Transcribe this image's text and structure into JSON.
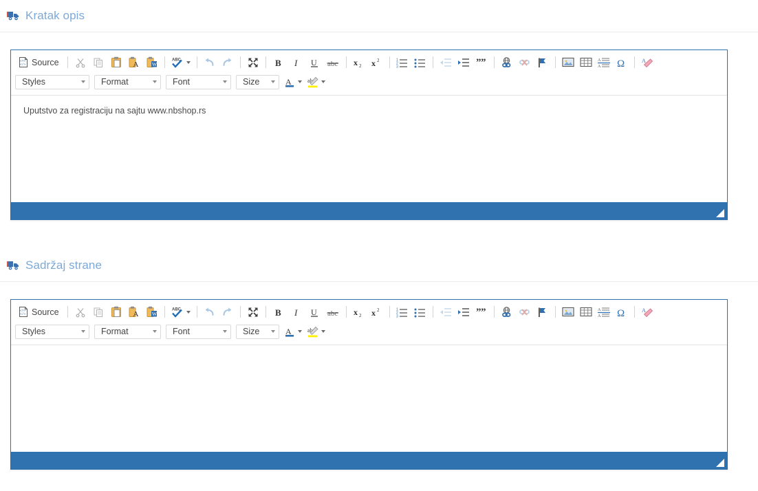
{
  "page": {
    "background": "#ffffff",
    "accent_blue": "#3072b0",
    "header_text_color": "#7da9d8"
  },
  "sections": [
    {
      "id": "kratak-opis",
      "header": {
        "icon": "truck-icon",
        "title": "Kratak opis"
      },
      "editor": {
        "content": "Uputstvo za registraciju na sajtu www.nbshop.rs"
      }
    },
    {
      "id": "sadrzaj-strane",
      "header": {
        "icon": "truck-icon",
        "title": "Sadržaj strane"
      },
      "editor": {
        "content": ""
      }
    }
  ],
  "toolbar": {
    "source_label": "Source",
    "row1": [
      {
        "name": "source-button",
        "label": "Source",
        "icon": "source-code-icon",
        "enabled": true
      },
      {
        "name": "cut-button",
        "icon": "scissors-icon",
        "enabled": false
      },
      {
        "name": "copy-button",
        "icon": "copy-icon",
        "enabled": false
      },
      {
        "name": "paste-button",
        "icon": "paste-icon",
        "enabled": true
      },
      {
        "name": "paste-as-text-button",
        "icon": "paste-text-icon",
        "enabled": true
      },
      {
        "name": "paste-from-word-button",
        "icon": "paste-word-icon",
        "enabled": true
      },
      {
        "name": "spell-check-button",
        "icon": "spell-check-icon",
        "enabled": true
      },
      {
        "name": "undo-button",
        "icon": "undo-icon",
        "enabled": false
      },
      {
        "name": "redo-button",
        "icon": "redo-icon",
        "enabled": false
      },
      {
        "name": "maximize-button",
        "icon": "maximize-icon",
        "enabled": true
      },
      {
        "name": "bold-button",
        "icon": "bold-icon",
        "enabled": true
      },
      {
        "name": "italic-button",
        "icon": "italic-icon",
        "enabled": true
      },
      {
        "name": "underline-button",
        "icon": "underline-icon",
        "enabled": true
      },
      {
        "name": "strikethrough-button",
        "icon": "strikethrough-icon",
        "enabled": true
      },
      {
        "name": "subscript-button",
        "icon": "subscript-icon",
        "enabled": true
      },
      {
        "name": "superscript-button",
        "icon": "superscript-icon",
        "enabled": true
      },
      {
        "name": "numbered-list-button",
        "icon": "numbered-list-icon",
        "enabled": true
      },
      {
        "name": "bulleted-list-button",
        "icon": "bulleted-list-icon",
        "enabled": true
      },
      {
        "name": "outdent-button",
        "icon": "outdent-icon",
        "enabled": false
      },
      {
        "name": "indent-button",
        "icon": "indent-icon",
        "enabled": true
      },
      {
        "name": "blockquote-button",
        "icon": "blockquote-icon",
        "enabled": true
      },
      {
        "name": "link-button",
        "icon": "link-icon",
        "enabled": true
      },
      {
        "name": "unlink-button",
        "icon": "unlink-icon",
        "enabled": false
      },
      {
        "name": "anchor-button",
        "icon": "anchor-flag-icon",
        "enabled": true
      },
      {
        "name": "image-button",
        "icon": "image-icon",
        "enabled": true
      },
      {
        "name": "table-button",
        "icon": "table-icon",
        "enabled": true
      },
      {
        "name": "horizontal-rule-button",
        "icon": "horizontal-rule-icon",
        "enabled": true
      },
      {
        "name": "special-char-button",
        "icon": "omega-icon",
        "enabled": true
      },
      {
        "name": "remove-format-button",
        "icon": "remove-format-icon",
        "enabled": true
      }
    ],
    "combos": {
      "styles": "Styles",
      "format": "Format",
      "font": "Font",
      "size": "Size"
    },
    "text_color_label": "A",
    "bg_color_label": "ab",
    "text_color_swatch": "#2f6fae",
    "bg_color_swatch": "#ffef00"
  }
}
